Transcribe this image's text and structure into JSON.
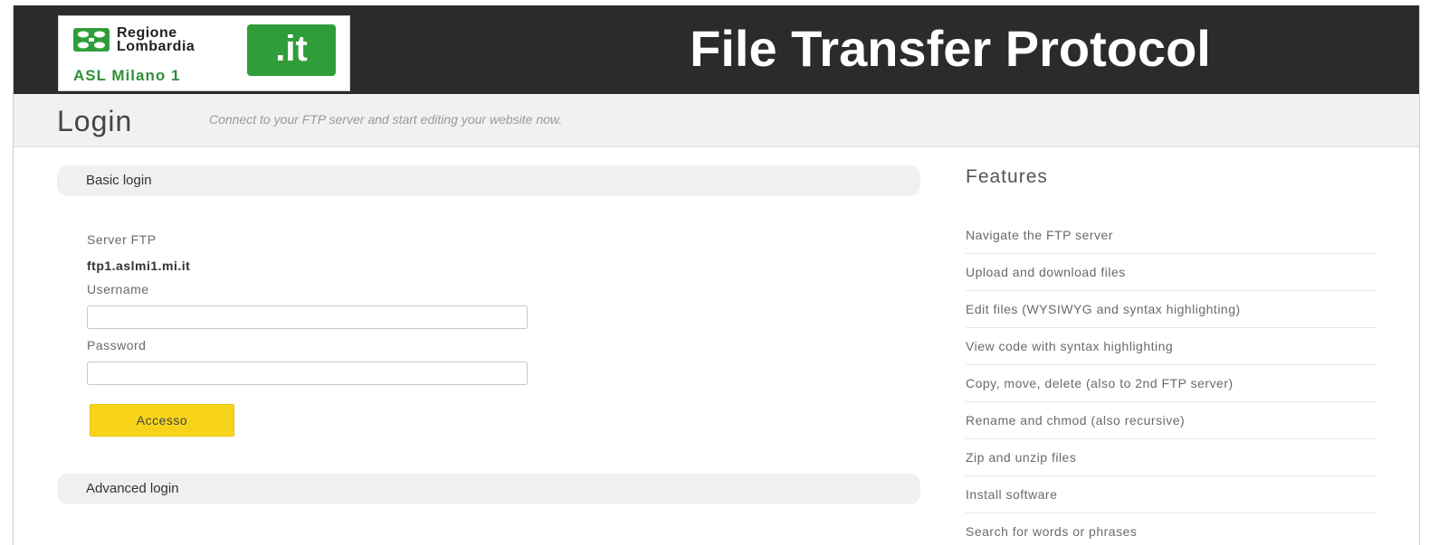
{
  "header": {
    "logo": {
      "line1": "Regione",
      "line2": "Lombardia",
      "subtitle": "ASL Milano 1",
      "domain_badge": ".it"
    },
    "title": "File Transfer Protocol"
  },
  "subheader": {
    "title": "Login",
    "tagline": "Connect to your FTP server and start editing your website now."
  },
  "basic_login": {
    "section_label": "Basic login",
    "server_label": "Server FTP",
    "server_value": "ftp1.aslmi1.mi.it",
    "username_label": "Username",
    "username_value": "",
    "password_label": "Password",
    "password_value": "",
    "submit_label": "Accesso"
  },
  "advanced_login": {
    "section_label": "Advanced login"
  },
  "features": {
    "title": "Features",
    "items": [
      "Navigate the FTP server",
      "Upload and download files",
      "Edit files (WYSIWYG and syntax highlighting)",
      "View code with syntax highlighting",
      "Copy, move, delete (also to 2nd FTP server)",
      "Rename and chmod (also recursive)",
      "Zip and unzip files",
      "Install software",
      "Search for words or phrases"
    ]
  },
  "colors": {
    "header_bg": "#2b2b2b",
    "brand_green": "#2f9e3a",
    "button_yellow": "#f7d41a",
    "subheader_bg": "#f1f1f1"
  }
}
